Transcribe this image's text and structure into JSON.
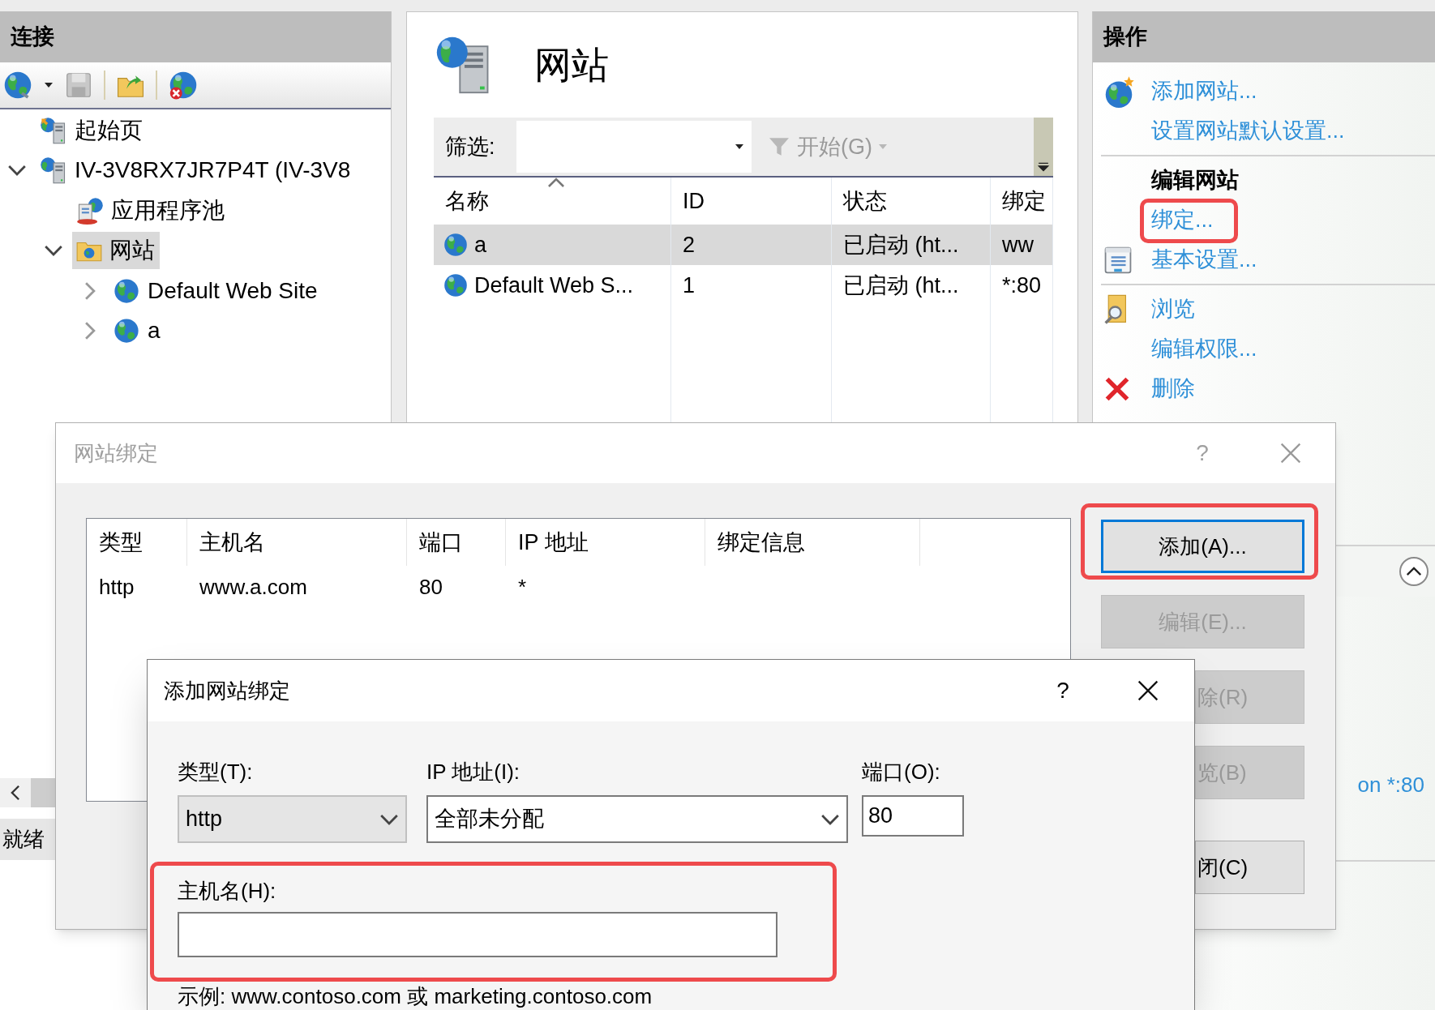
{
  "connections": {
    "title": "连接",
    "tree": [
      {
        "label": "起始页",
        "kind": "start",
        "selected": false
      },
      {
        "label": "IV-3V8RX7JR7P4T (IV-3V8",
        "kind": "server",
        "expanded": true,
        "selected": false,
        "children": [
          {
            "label": "应用程序池",
            "kind": "pools",
            "selected": false
          },
          {
            "label": "网站",
            "kind": "sites",
            "expanded": true,
            "selected": true,
            "children": [
              {
                "label": "Default Web Site",
                "kind": "site",
                "expanded": false,
                "selected": false
              },
              {
                "label": "a",
                "kind": "site",
                "expanded": false,
                "selected": false
              }
            ]
          }
        ]
      }
    ],
    "status_bar": "就绪"
  },
  "center": {
    "title": "网站",
    "filter": {
      "label": "筛选:",
      "go_button": "开始(G)"
    },
    "table": {
      "columns": [
        "名称",
        "ID",
        "状态",
        "绑定"
      ],
      "rows": [
        {
          "cells": [
            "a",
            "2",
            "已启动 (ht...",
            "ww"
          ],
          "selected": true
        },
        {
          "cells": [
            "Default Web S...",
            "1",
            "已启动 (ht...",
            "*:80"
          ],
          "selected": false
        }
      ]
    }
  },
  "actions": {
    "title": "操作",
    "items": [
      {
        "kind": "link",
        "label": "添加网站...",
        "highlighted": false
      },
      {
        "kind": "link",
        "label": "设置网站默认设置...",
        "highlighted": false
      },
      {
        "kind": "separator"
      },
      {
        "kind": "heading",
        "label": "编辑网站"
      },
      {
        "kind": "link",
        "label": "绑定...",
        "highlighted": true
      },
      {
        "kind": "link",
        "label": "基本设置...",
        "highlighted": false
      },
      {
        "kind": "separator"
      },
      {
        "kind": "link",
        "label": "浏览",
        "highlighted": false
      },
      {
        "kind": "link",
        "label": "编辑权限...",
        "highlighted": false
      },
      {
        "kind": "link",
        "label": "删除",
        "highlighted": false
      }
    ],
    "details_fragment": "on *:80"
  },
  "bindings_dialog": {
    "title": "网站绑定",
    "help_button": "?",
    "columns": [
      "类型",
      "主机名",
      "端口",
      "IP 地址",
      "绑定信息"
    ],
    "rows": [
      [
        "http",
        "www.a.com",
        "80",
        "*"
      ]
    ],
    "buttons": [
      {
        "label": "添加(A)...",
        "disabled": false,
        "focused": true,
        "highlighted": true,
        "clipped": false
      },
      {
        "label": "编辑(E)...",
        "disabled": true,
        "focused": false,
        "highlighted": false,
        "clipped": false
      },
      {
        "label": "除(R)",
        "disabled": true,
        "focused": false,
        "highlighted": false,
        "clipped": true
      },
      {
        "label": "览(B)",
        "disabled": true,
        "focused": false,
        "highlighted": false,
        "clipped": true
      },
      {
        "label": "闭(C)",
        "disabled": false,
        "focused": false,
        "highlighted": false,
        "clipped": true
      }
    ]
  },
  "add_binding_dialog": {
    "title": "添加网站绑定",
    "help_button": "?",
    "type": {
      "label": "类型(T):",
      "value": "http"
    },
    "ip": {
      "label": "IP 地址(I):",
      "value": "全部未分配"
    },
    "port": {
      "label": "端口(O):",
      "value": "80"
    },
    "host": {
      "label": "主机名(H):",
      "highlighted": true
    },
    "example": "示例: www.contoso.com 或 marketing.contoso.com"
  }
}
